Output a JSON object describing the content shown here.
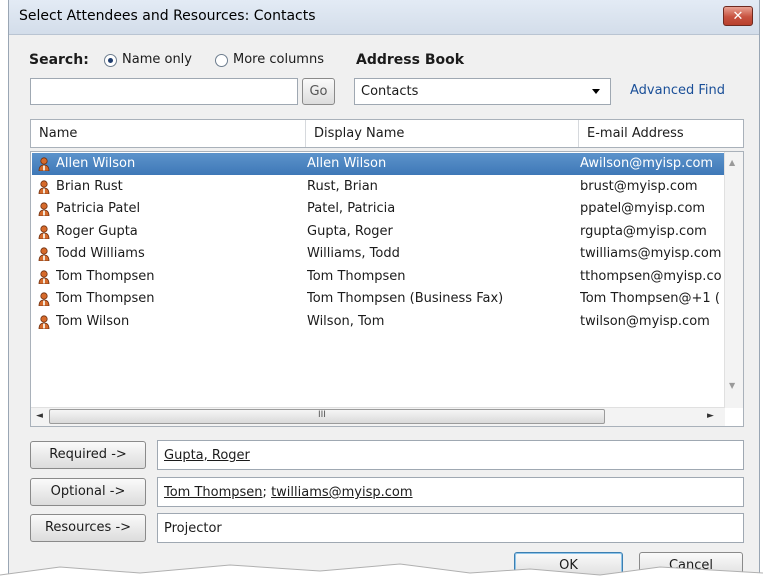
{
  "window": {
    "title": "Select Attendees and Resources: Contacts",
    "close_glyph": "✕"
  },
  "search": {
    "label": "Search:",
    "option_name_only": "Name only",
    "option_more_columns": "More columns",
    "selected_option": "Name only",
    "value": "",
    "go_label": "Go"
  },
  "address_book": {
    "label": "Address Book",
    "selected": "Contacts",
    "advanced_find": "Advanced Find"
  },
  "columns": [
    "Name",
    "Display Name",
    "E-mail Address"
  ],
  "contacts": [
    {
      "name": "Allen Wilson",
      "display": "Allen Wilson",
      "email": "Awilson@myisp.com",
      "selected": true
    },
    {
      "name": "Brian Rust",
      "display": "Rust, Brian",
      "email": "brust@myisp.com"
    },
    {
      "name": "Patricia Patel",
      "display": "Patel, Patricia",
      "email": "ppatel@myisp.com"
    },
    {
      "name": "Roger Gupta",
      "display": "Gupta, Roger",
      "email": "rgupta@myisp.com"
    },
    {
      "name": "Todd Williams",
      "display": "Williams, Todd",
      "email": "twilliams@myisp.com"
    },
    {
      "name": "Tom Thompsen",
      "display": "Tom Thompsen",
      "email": "tthompsen@myisp.co"
    },
    {
      "name": "Tom Thompsen",
      "display": "Tom Thompsen (Business Fax)",
      "email": "Tom Thompsen@+1 ("
    },
    {
      "name": "Tom Wilson",
      "display": "Wilson, Tom",
      "email": "twilson@myisp.com"
    }
  ],
  "scroll": {
    "left_arrow": "◄",
    "right_arrow": "►",
    "up_arrow": "▲",
    "down_arrow": "▼",
    "grip": "III"
  },
  "recipients": {
    "required_label": "Required ->",
    "required_value": "Gupta, Roger",
    "optional_label": "Optional ->",
    "optional_values": [
      "Tom Thompsen",
      "twilliams@myisp.com"
    ],
    "optional_separator": "; ",
    "resources_label": "Resources ->",
    "resources_value": "Projector"
  },
  "footer": {
    "ok_label": "OK",
    "cancel_label": "Cancel"
  },
  "colors": {
    "selection": "#3e78b7",
    "link": "#1a4f98",
    "close": "#c75240"
  }
}
